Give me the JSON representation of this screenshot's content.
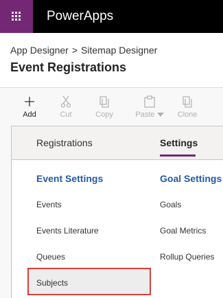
{
  "app": {
    "name": "PowerApps"
  },
  "breadcrumb": {
    "items": [
      "App Designer",
      "Sitemap Designer"
    ],
    "separator": ">"
  },
  "page_title": "Event Registrations",
  "toolbar": {
    "items": [
      {
        "label": "Add",
        "icon": "plus-icon",
        "enabled": true
      },
      {
        "label": "Cut",
        "icon": "scissors-icon",
        "enabled": false
      },
      {
        "label": "Copy",
        "icon": "copy-icon",
        "enabled": false
      },
      {
        "label": "Paste",
        "icon": "paste-icon",
        "enabled": false
      },
      {
        "label": "Clone",
        "icon": "clone-icon",
        "enabled": false
      }
    ]
  },
  "tabs": [
    {
      "label": "Registrations",
      "active": false
    },
    {
      "label": "Settings",
      "active": true
    }
  ],
  "groups": [
    {
      "title": "Event Settings",
      "items": [
        "Events",
        "Events Literature",
        "Queues",
        "Subjects"
      ]
    },
    {
      "title": "Goal Settings",
      "items": [
        "Goals",
        "Goal Metrics",
        "Rollup Queries"
      ]
    }
  ],
  "selected_item": "Subjects",
  "colors": {
    "brand": "#742774",
    "link": "#2359a6",
    "highlight_border": "#d43f3a"
  }
}
